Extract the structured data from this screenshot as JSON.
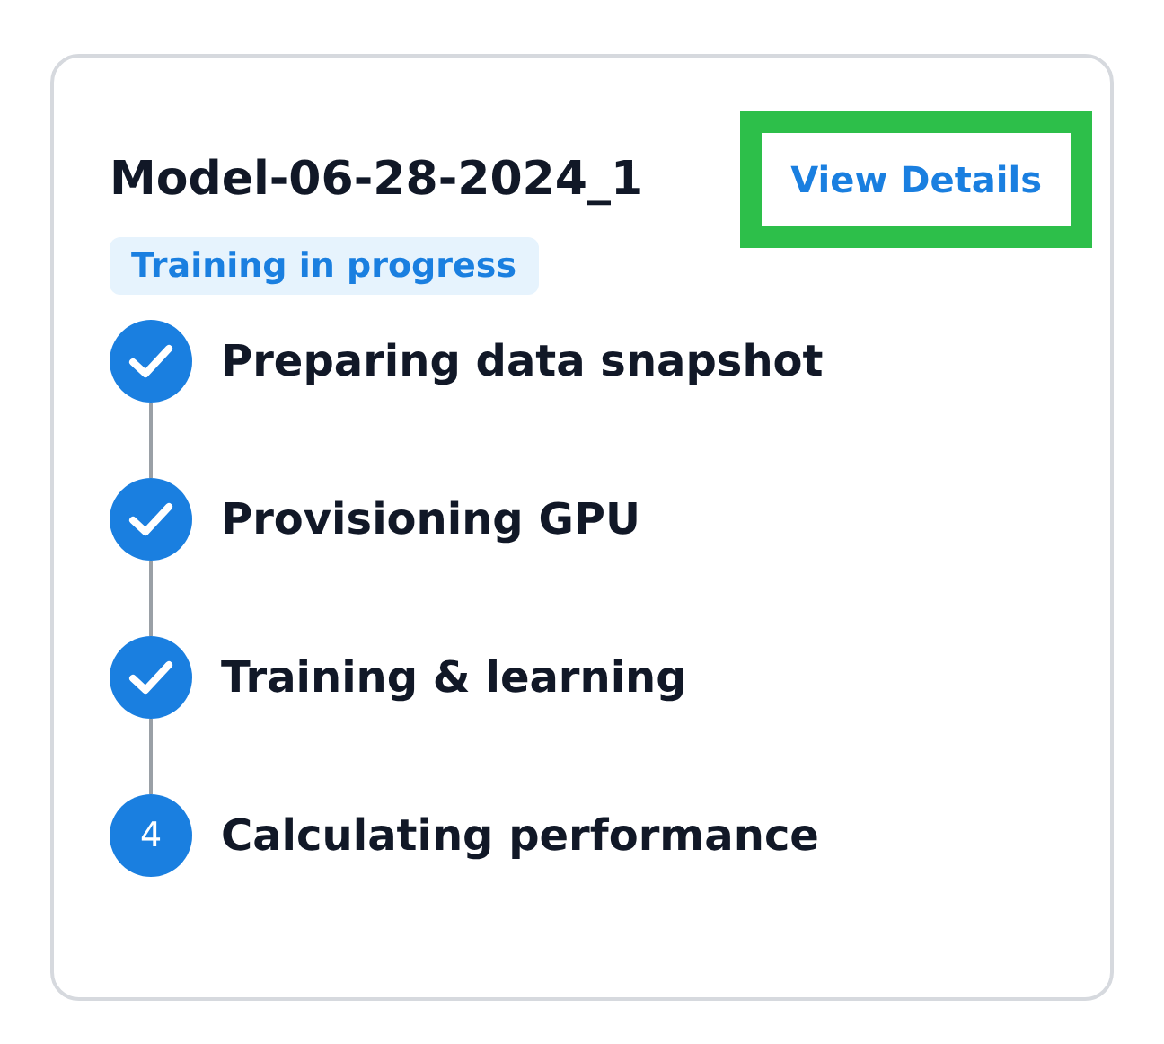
{
  "card": {
    "title": "Model-06-28-2024_1",
    "action": {
      "label": "View Details",
      "highlighted": true
    },
    "status_badge": "Training in progress",
    "steps": [
      {
        "label": "Preparing data snapshot",
        "completed": true
      },
      {
        "label": "Provisioning GPU",
        "completed": true
      },
      {
        "label": "Training & learning",
        "completed": true
      },
      {
        "label": "Calculating performance",
        "completed": false,
        "number": "4"
      }
    ]
  }
}
